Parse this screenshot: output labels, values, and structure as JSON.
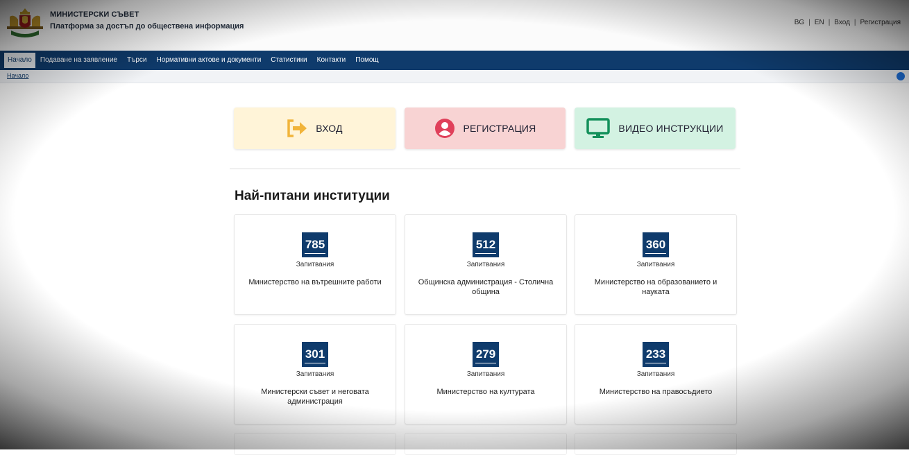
{
  "header": {
    "org_name": "МИНИСТЕРСКИ СЪВЕТ",
    "platform_name": "Платформа за достъп до обществена информация",
    "links": {
      "bg": "BG",
      "en": "EN",
      "login": "Вход",
      "register": "Регистрация"
    }
  },
  "nav": {
    "items": [
      "Начало",
      "Подаване на заявление",
      "Търси",
      "Нормативни актове и документи",
      "Статистики",
      "Контакти",
      "Помощ"
    ]
  },
  "breadcrumb": {
    "home": "Начало"
  },
  "actions": {
    "login": "ВХОД",
    "register": "РЕГИСТРАЦИЯ",
    "video": "ВИДЕО ИНСТРУКЦИИ"
  },
  "colors": {
    "nav_bg": "#0f3b6c",
    "login_bg": "#fff4d8",
    "register_bg": "#f8d3d3",
    "video_bg": "#d3f2e2",
    "login_icon": "#f1b43a",
    "register_icon": "#e0405a",
    "video_icon": "#13905a"
  },
  "section_title": "Най-питани институции",
  "institutions": [
    {
      "count": "785",
      "unit": "Запитвания",
      "name": "Министерство на вътрешните работи"
    },
    {
      "count": "512",
      "unit": "Запитвания",
      "name": "Общинска администрация - Столична община"
    },
    {
      "count": "360",
      "unit": "Запитвания",
      "name": "Министерство на образованието и науката"
    },
    {
      "count": "301",
      "unit": "Запитвания",
      "name": "Министерски съвет и неговата администрация"
    },
    {
      "count": "279",
      "unit": "Запитвания",
      "name": "Министерство на културата"
    },
    {
      "count": "233",
      "unit": "Запитвания",
      "name": "Министерство на правосъдието"
    }
  ]
}
